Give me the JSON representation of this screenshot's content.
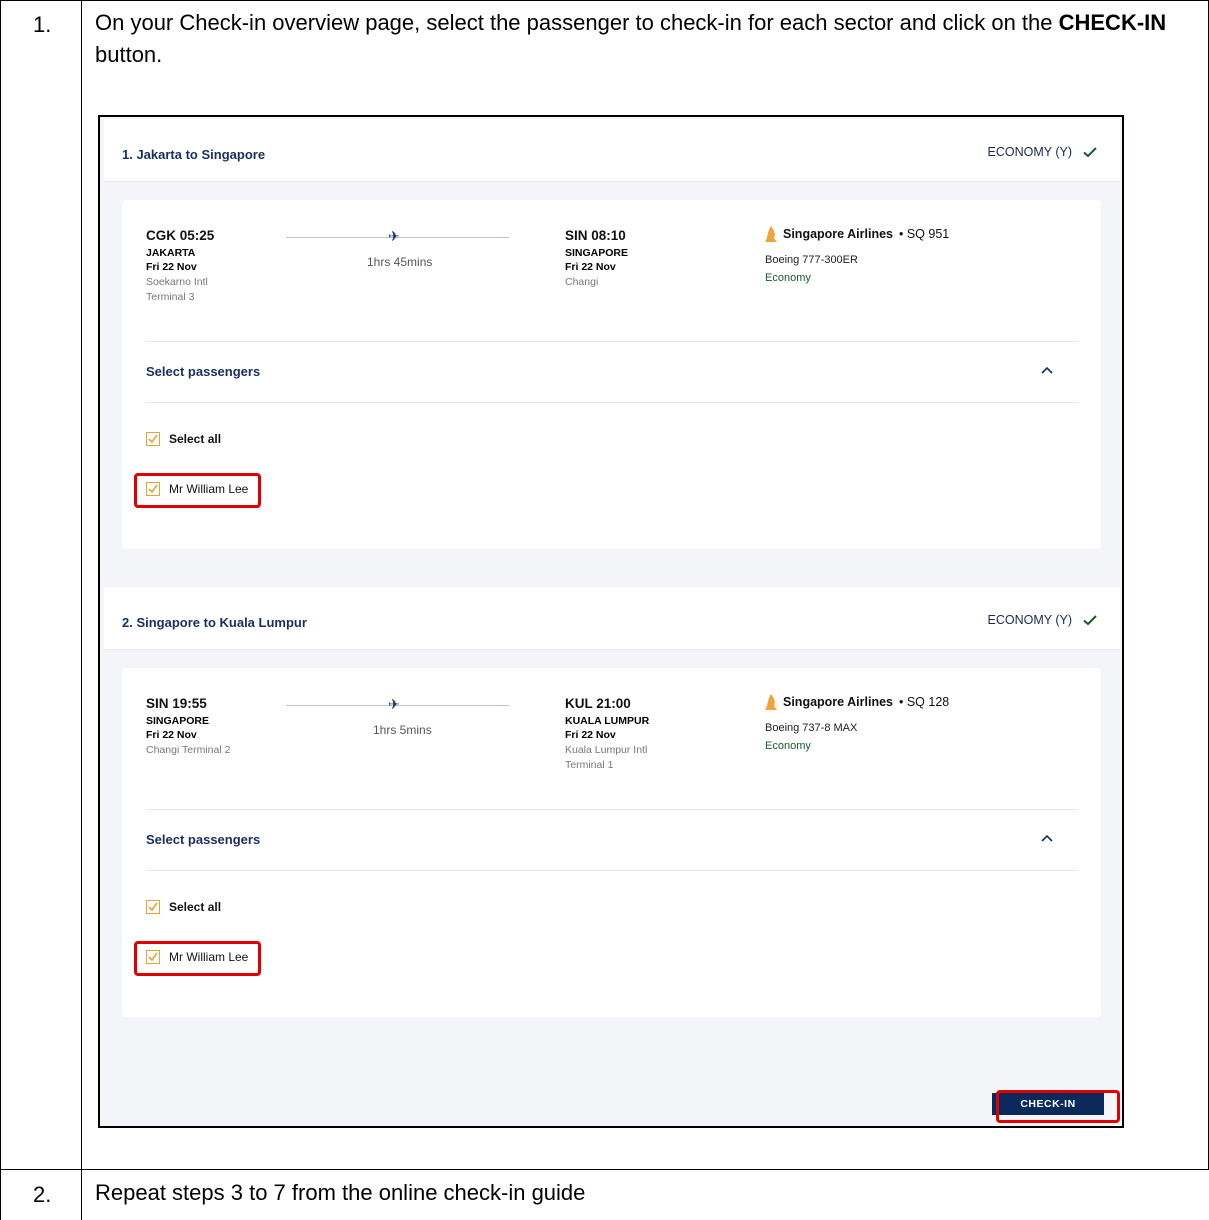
{
  "steps": [
    {
      "number": "1.",
      "text_before": "On your Check-in overview page, select the passenger to check-in for each sector and click on the ",
      "text_bold": "CHECK-IN",
      "text_after": " button."
    },
    {
      "number": "2.",
      "text": "Repeat steps 3 to 7 from the online check-in guide"
    }
  ],
  "sectors": [
    {
      "title": "1. Jakarta to Singapore",
      "cabin": "ECONOMY (Y)",
      "depart": {
        "code_time": "CGK 05:25",
        "city": "JAKARTA",
        "date": "Fri 22 Nov",
        "airport": "Soekarno Intl",
        "terminal": "Terminal 3"
      },
      "duration": "1hrs 45mins",
      "arrive": {
        "code_time": "SIN 08:10",
        "city": "SINGAPORE",
        "date": "Fri 22 Nov",
        "airport": "Changi",
        "terminal": ""
      },
      "airline": "Singapore Airlines",
      "flight": "• SQ 951",
      "aircraft": "Boeing 777-300ER",
      "class": "Economy",
      "select_passengers": "Select passengers",
      "select_all": "Select all",
      "passenger": "Mr William Lee"
    },
    {
      "title": "2. Singapore to Kuala Lumpur",
      "cabin": "ECONOMY (Y)",
      "depart": {
        "code_time": "SIN 19:55",
        "city": "SINGAPORE",
        "date": "Fri 22 Nov",
        "airport": "Changi Terminal 2",
        "terminal": ""
      },
      "duration": "1hrs 5mins",
      "arrive": {
        "code_time": "KUL 21:00",
        "city": "KUALA LUMPUR",
        "date": "Fri 22 Nov",
        "airport": "Kuala Lumpur Intl",
        "terminal": "Terminal 1"
      },
      "airline": "Singapore Airlines",
      "flight": "• SQ 128",
      "aircraft": "Boeing 737-8 MAX",
      "class": "Economy",
      "select_passengers": "Select passengers",
      "select_all": "Select all",
      "passenger": "Mr William Lee"
    }
  ],
  "checkin_button": "CHECK-IN",
  "colors": {
    "navy": "#16305f",
    "button": "#0b2a5b",
    "highlight": "#e00000",
    "checkbox": "#e8a23b",
    "tick_green": "#1d5a2a"
  }
}
